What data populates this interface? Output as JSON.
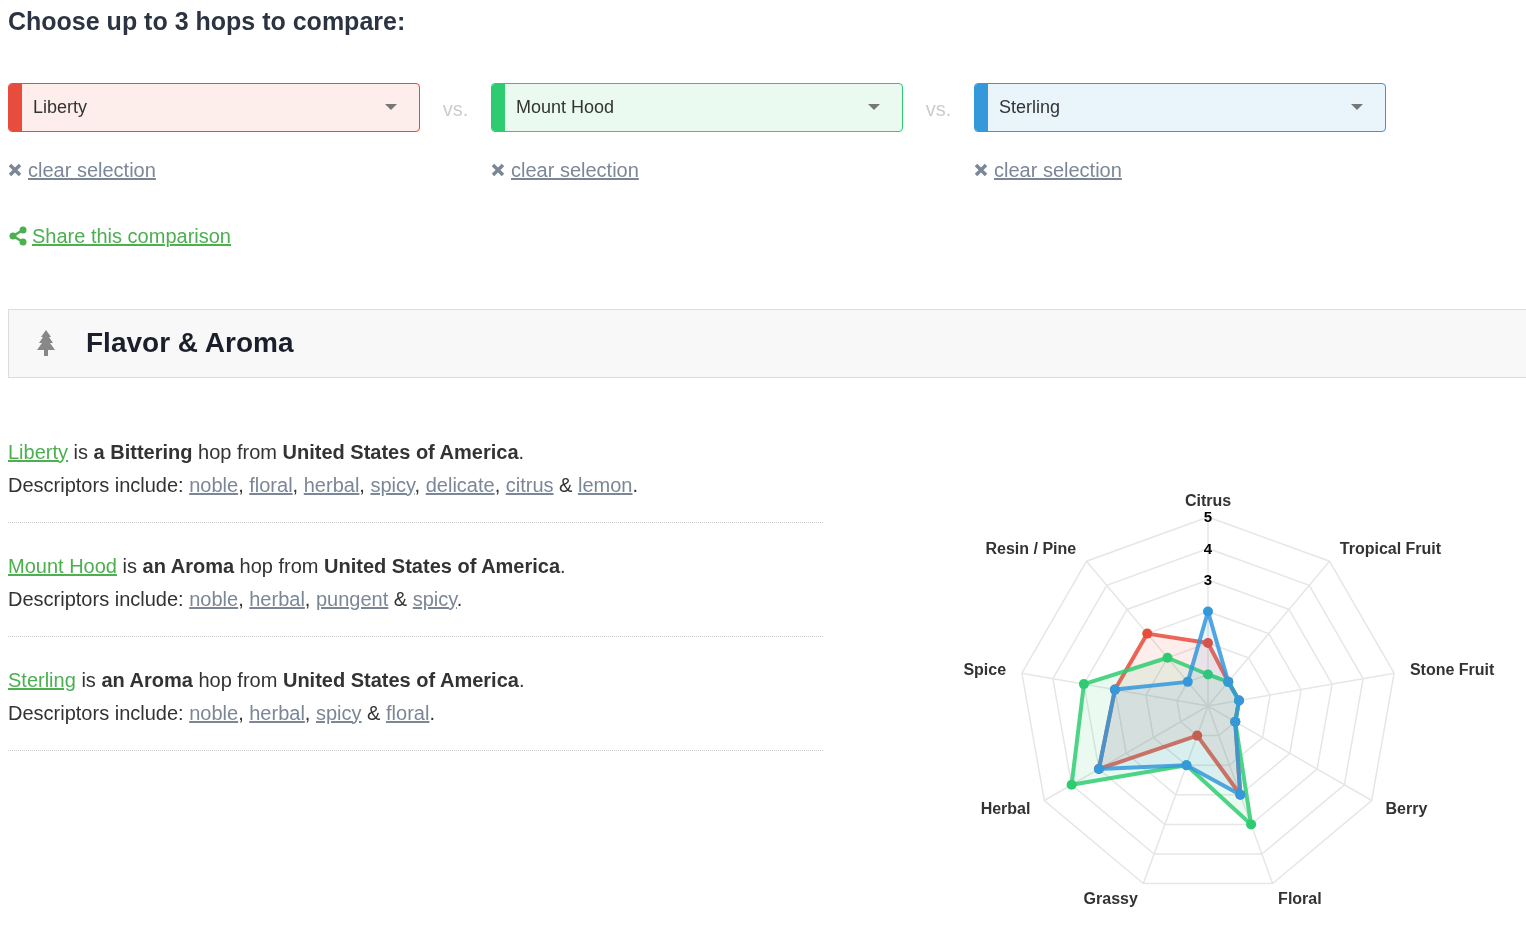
{
  "heading": "Choose up to 3 hops to compare:",
  "selectors": [
    {
      "value": "Liberty",
      "color": "#e74c3c",
      "clear_link": "clear selection"
    },
    {
      "value": "Mount Hood",
      "color": "#2ecc71",
      "clear_link": "clear selection"
    },
    {
      "value": "Sterling",
      "color": "#3498db",
      "clear_link": "clear selection"
    }
  ],
  "versus": [
    "vs.",
    "vs."
  ],
  "share_link": "Share this comparison",
  "section": {
    "title": "Flavor & Aroma",
    "hops": [
      {
        "name": "Liberty",
        "sentence": "is **a Bittering** hop from **United States of America**.",
        "descriptors_label": "Descriptors include:",
        "descriptors": [
          {
            "word": "noble",
            "sep": ","
          },
          {
            "word": "floral",
            "sep": ","
          },
          {
            "word": "herbal",
            "sep": ","
          },
          {
            "word": "spicy",
            "sep": ","
          },
          {
            "word": "delicate",
            "sep": ","
          },
          {
            "word": "citrus",
            "sep": " &"
          },
          {
            "word": "lemon",
            "sep": "."
          }
        ]
      },
      {
        "name": "Mount Hood",
        "sentence": "is **an Aroma** hop from **United States of America**.",
        "descriptors_label": "Descriptors include:",
        "descriptors": [
          {
            "word": "noble",
            "sep": ","
          },
          {
            "word": "herbal",
            "sep": ","
          },
          {
            "word": "pungent",
            "sep": " &"
          },
          {
            "word": "spicy",
            "sep": "."
          }
        ]
      },
      {
        "name": "Sterling",
        "sentence": "is **an Aroma** hop from **United States of America**.",
        "descriptors_label": "Descriptors include:",
        "descriptors": [
          {
            "word": "noble",
            "sep": ","
          },
          {
            "word": "herbal",
            "sep": ","
          },
          {
            "word": "spicy",
            "sep": " &"
          },
          {
            "word": "floral",
            "sep": "."
          }
        ]
      }
    ],
    "radar": {
      "axis_labels": [
        "Citrus",
        "Tropical Fruit",
        "Stone Fruit",
        "Berry",
        "Floral",
        "Grassy",
        "Herbal",
        "Spice",
        "Resin / Pine"
      ],
      "tick_labels": [
        "5",
        "4",
        "3"
      ]
    }
  }
}
